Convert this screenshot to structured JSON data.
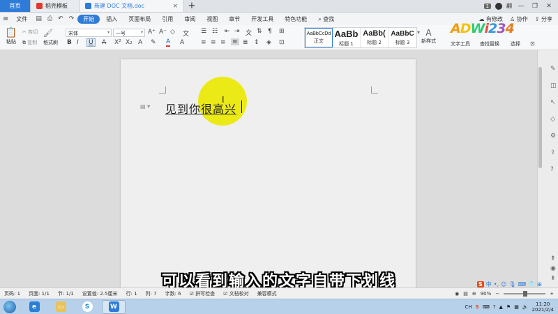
{
  "tabbar": {
    "home": "首页",
    "tabs": [
      {
        "label": "稻壳模板"
      },
      {
        "label": "新建 DOC 文档.doc"
      }
    ],
    "new_tab": "+",
    "page_num": "1",
    "user_name": "翩"
  },
  "menubar": {
    "file": "文件",
    "items": [
      "开始",
      "插入",
      "页面布局",
      "引用",
      "审阅",
      "视图",
      "章节",
      "开发工具",
      "特色功能"
    ],
    "active": "开始",
    "search": "查找",
    "right": {
      "unsaved": "有修改",
      "collab": "协作",
      "share": "分享"
    }
  },
  "ribbon": {
    "paste": "粘贴",
    "cut": "剪切",
    "copy": "复制",
    "format_painter": "格式刷",
    "font_name": "宋体",
    "font_size": "一号",
    "styles": [
      {
        "sample": "AaBbCcDd",
        "name": "正文"
      },
      {
        "sample": "AaBb",
        "name": "标题 1"
      },
      {
        "sample": "AaBb(",
        "name": "标题 2"
      },
      {
        "sample": "AaBbC",
        "name": "标题 3"
      }
    ],
    "new_style": "新样式",
    "text_tools": "文字工具",
    "find_replace": "查找替换",
    "select": "选择",
    "logo_text": "ADWi234",
    "colors": {
      "accent": "#2f7bd8",
      "highlight": "#ecea16",
      "font_color": "#e53935"
    }
  },
  "document": {
    "text": "见到你很高兴"
  },
  "caption": "可以看到输入的文字自带下划线",
  "statusbar": {
    "page_num": "页码: 1",
    "pages": "页面: 1/1",
    "section": "节: 1/1",
    "setting": "设置值: 2.5厘米",
    "row": "行: 1",
    "col": "列: 7",
    "words": "字数: 6",
    "spell": "拼写检查",
    "proof": "文档校对",
    "compat": "兼容模式",
    "zoom": "90%",
    "ime": "中"
  },
  "taskbar": {
    "tray_ch": "CH",
    "time": "11:20",
    "date": "2021/2/4"
  }
}
